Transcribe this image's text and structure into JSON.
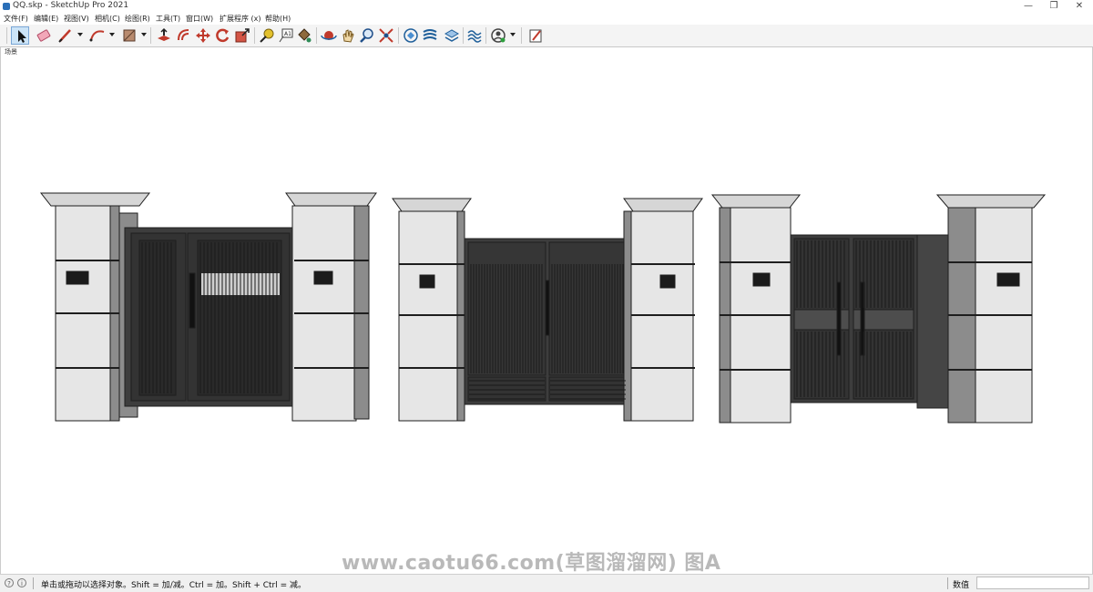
{
  "window": {
    "title": "QQ.skp - SketchUp Pro 2021",
    "minimize_glyph": "—",
    "restore_glyph": "❐",
    "close_glyph": "✕"
  },
  "menu": {
    "items": [
      "文件(F)",
      "编辑(E)",
      "视图(V)",
      "相机(C)",
      "绘图(R)",
      "工具(T)",
      "窗口(W)",
      "扩展程序 (x)",
      "帮助(H)"
    ]
  },
  "toolbar": {
    "tools": [
      "select-arrow-icon",
      "eraser-icon",
      "pencil-line-icon",
      "arc-icon",
      "rectangle-icon",
      "push-pull-icon",
      "offset-icon",
      "move-icon",
      "rotate-icon",
      "scale-icon",
      "tape-measure-icon",
      "text-label-icon",
      "paint-bucket-icon",
      "orbit-icon",
      "pan-icon",
      "zoom-icon",
      "zoom-extents-icon",
      "warehouse-icon",
      "extension-warehouse-icon",
      "layer-manager-icon",
      "sandbox-icon",
      "user-account-icon",
      "layout-icon"
    ],
    "active_tool": "select-arrow-icon"
  },
  "viewport": {
    "scene_label": "场景",
    "watermark": "www.caotu66.com(草图溜溜网) 图A",
    "colors": {
      "pillar_light": "#e6e6e6",
      "pillar_shade": "#8c8c8c",
      "gate_dark": "#3d3d3d",
      "gate_line": "#1e1e1e"
    }
  },
  "status": {
    "hint": "单击或拖动以选择对象。Shift = 加/减。Ctrl = 加。Shift + Ctrl = 减。",
    "value_label": "数值",
    "value": "",
    "icon_geo": "?",
    "icon_info": "i"
  }
}
